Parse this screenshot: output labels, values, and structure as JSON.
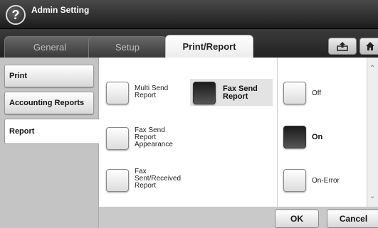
{
  "header": {
    "title": "Admin Setting",
    "help_glyph": "?"
  },
  "tabs": [
    {
      "label": "General",
      "active": false
    },
    {
      "label": "Setup",
      "active": false
    },
    {
      "label": "Print/Report",
      "active": true
    }
  ],
  "sidebar": {
    "items": [
      {
        "label": "Print",
        "selected": false
      },
      {
        "label": "Accounting Reports",
        "selected": false
      },
      {
        "label": "Report",
        "selected": true
      }
    ]
  },
  "reports": [
    {
      "label": "Multi Send\nReport",
      "selected": false
    },
    {
      "label": "Fax Send\nReport",
      "selected": true
    },
    {
      "label": "Fax Send\nReport\nAppearance",
      "selected": false
    },
    {
      "label": "Fax\nSent/Received\nReport",
      "selected": false
    }
  ],
  "options": [
    {
      "label": "Off",
      "selected": false
    },
    {
      "label": "On",
      "selected": true
    },
    {
      "label": "On-Error",
      "selected": false
    }
  ],
  "footer": {
    "ok_label": "OK",
    "cancel_label": "Cancel"
  },
  "colors": {
    "titlebar": "#1c1c1c",
    "panel": "#c4c4c4",
    "selected": "#1a1a1a"
  }
}
